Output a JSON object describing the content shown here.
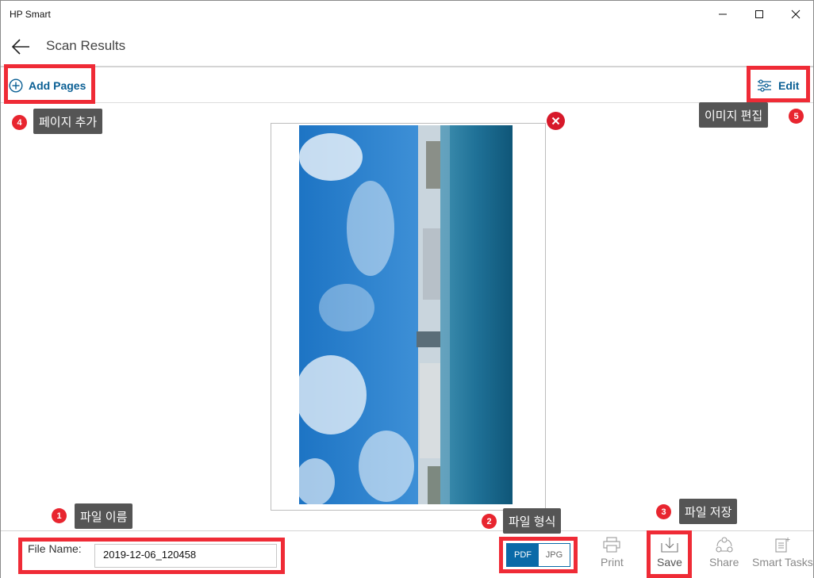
{
  "window": {
    "title": "HP Smart"
  },
  "header": {
    "title": "Scan Results"
  },
  "toolbar": {
    "add_pages_label": "Add Pages",
    "edit_label": "Edit"
  },
  "annotations": [
    {
      "number": "1",
      "text": "파일 이름"
    },
    {
      "number": "2",
      "text": "파일 형식"
    },
    {
      "number": "3",
      "text": "파일 저장"
    },
    {
      "number": "4",
      "text": "페이지 추가"
    },
    {
      "number": "5",
      "text": "이미지 편집"
    }
  ],
  "file": {
    "name_label": "File Name:",
    "name_value": "2019-12-06_120458"
  },
  "format": {
    "options": [
      "PDF",
      "JPG"
    ],
    "selected": "PDF"
  },
  "actions": [
    {
      "label": "Print",
      "icon": "printer-icon",
      "enabled": false
    },
    {
      "label": "Save",
      "icon": "save-download-icon",
      "enabled": true
    },
    {
      "label": "Share",
      "icon": "share-icon",
      "enabled": false
    },
    {
      "label": "Smart Tasks",
      "icon": "smart-tasks-icon",
      "enabled": false
    }
  ],
  "colors": {
    "accent": "#0a6aa8",
    "link": "#0a5f94",
    "highlight": "#ef2b36",
    "badge": "#e8252f",
    "tooltip_bg": "#555555"
  }
}
